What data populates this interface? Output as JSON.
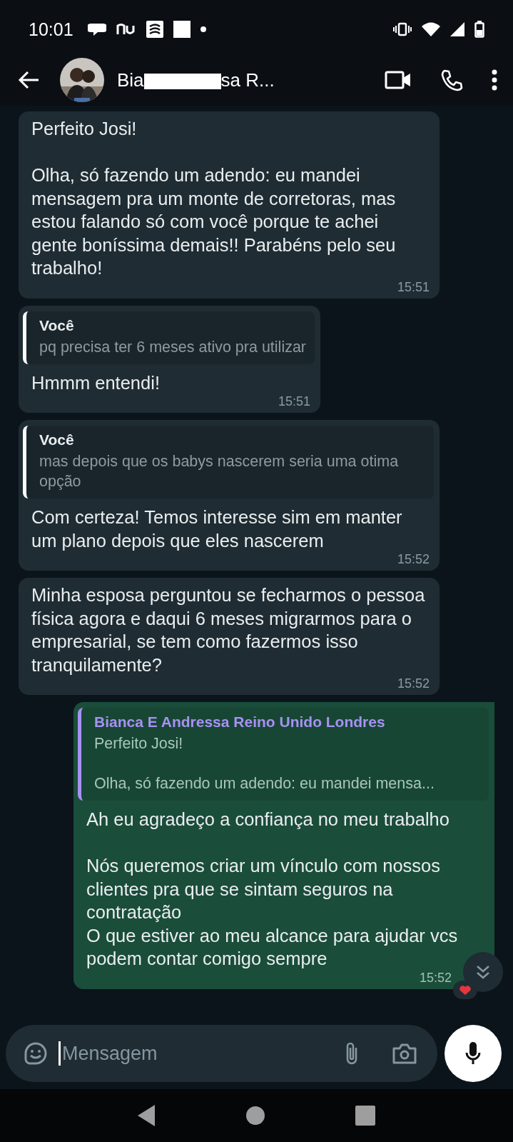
{
  "status_bar": {
    "time": "10:01"
  },
  "header": {
    "name_start": "Bia",
    "name_end": "sa R...",
    "redacted": true
  },
  "messages": [
    {
      "kind": "in",
      "text": "Perfeito Josi!\n\nOlha, só fazendo um adendo: eu mandei mensagem pra um monte de corretoras, mas estou falando só com você porque te achei gente boníssima demais!! Parabéns pelo seu trabalho!",
      "time": "15:51"
    },
    {
      "kind": "in",
      "quote": {
        "author": "Você",
        "text": "pq precisa ter 6 meses ativo pra utilizar",
        "color": "#ffffff"
      },
      "text": "Hmmm entendi!",
      "time": "15:51"
    },
    {
      "kind": "in",
      "quote": {
        "author": "Você",
        "text": "mas depois que os babys nascerem seria uma otima opção",
        "color": "#ffffff"
      },
      "text": "Com certeza! Temos interesse sim em manter um plano depois que eles nascerem",
      "time": "15:52"
    },
    {
      "kind": "in",
      "text": "Minha esposa perguntou se fecharmos o pessoa física agora e daqui 6 meses migrarmos para o empresarial, se tem como fazermos isso tranquilamente?",
      "time": "15:52"
    },
    {
      "kind": "out",
      "quote": {
        "author": "Bianca E Andressa Reino Unido Londres",
        "text": "Perfeito Josi!\n\nOlha, só fazendo um adendo: eu mandei mensa...",
        "color": "#a791f4"
      },
      "text": "Ah eu agradeço a confiança no meu trabalho\n\nNós queremos criar um vínculo com nossos clientes pra que se sintam seguros na contratação\nO que estiver ao meu alcance para ajudar vcs podem contar comigo sempre",
      "time": "15:52",
      "reaction": true
    }
  ],
  "composer": {
    "placeholder": "Mensagem"
  }
}
